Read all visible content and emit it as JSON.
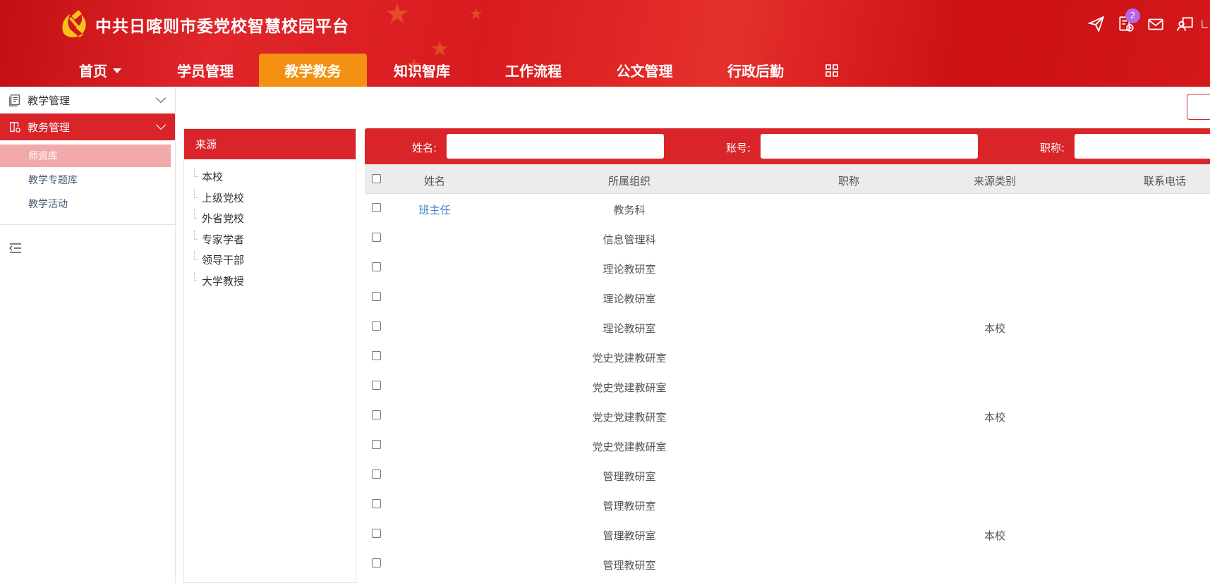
{
  "header": {
    "title": "中共日喀则市委党校智慧校园平台",
    "notification_count": "2",
    "icons": [
      "send-icon",
      "schedule-icon",
      "mail-icon",
      "presentation-icon",
      "document-icon"
    ]
  },
  "nav": {
    "items": [
      {
        "label": "首页",
        "dropdown": true
      },
      {
        "label": "学员管理"
      },
      {
        "label": "教学教务",
        "active": true
      },
      {
        "label": "知识智库"
      },
      {
        "label": "工作流程"
      },
      {
        "label": "公文管理"
      },
      {
        "label": "行政后勤"
      }
    ]
  },
  "sidebar": {
    "groups": [
      {
        "label": "教学管理",
        "open": false
      },
      {
        "label": "教务管理",
        "open": true,
        "items": [
          {
            "label": "师资库",
            "active": true
          },
          {
            "label": "教学专题库"
          },
          {
            "label": "教学活动"
          }
        ]
      }
    ]
  },
  "source_panel": {
    "title": "来源",
    "items": [
      "本校",
      "上级党校",
      "外省党校",
      "专家学者",
      "领导干部",
      "大学教授"
    ]
  },
  "filters": {
    "name_label": "姓名:",
    "account_label": "账号:",
    "title_label": "职称:"
  },
  "table": {
    "columns": [
      "姓名",
      "所属组织",
      "职称",
      "来源类别",
      "联系电话"
    ],
    "rows": [
      {
        "name": "班主任",
        "org": "教务科",
        "title": "",
        "source": "",
        "phone": ""
      },
      {
        "name": "",
        "org": "信息管理科",
        "title": "",
        "source": "",
        "phone": ""
      },
      {
        "name": "",
        "org": "理论教研室",
        "title": "",
        "source": "",
        "phone": ""
      },
      {
        "name": "",
        "org": "理论教研室",
        "title": "",
        "source": "",
        "phone": ""
      },
      {
        "name": "",
        "org": "理论教研室",
        "title": "",
        "source": "本校",
        "phone": ""
      },
      {
        "name": "",
        "org": "党史党建教研室",
        "title": "",
        "source": "",
        "phone": ""
      },
      {
        "name": "",
        "org": "党史党建教研室",
        "title": "",
        "source": "",
        "phone": ""
      },
      {
        "name": "",
        "org": "党史党建教研室",
        "title": "",
        "source": "本校",
        "phone": ""
      },
      {
        "name": "",
        "org": "党史党建教研室",
        "title": "",
        "source": "",
        "phone": ""
      },
      {
        "name": "",
        "org": "管理教研室",
        "title": "",
        "source": "",
        "phone": ""
      },
      {
        "name": "",
        "org": "管理教研室",
        "title": "",
        "source": "",
        "phone": ""
      },
      {
        "name": "",
        "org": "管理教研室",
        "title": "",
        "source": "本校",
        "phone": ""
      },
      {
        "name": "",
        "org": "管理教研室",
        "title": "",
        "source": "",
        "phone": ""
      }
    ]
  },
  "colors": {
    "primary_red": "#d9252a",
    "active_orange": "#f39212",
    "active_sub_bg": "#f1a9a9",
    "link_blue": "#3b7bd0",
    "badge_purple": "#b665e8"
  }
}
